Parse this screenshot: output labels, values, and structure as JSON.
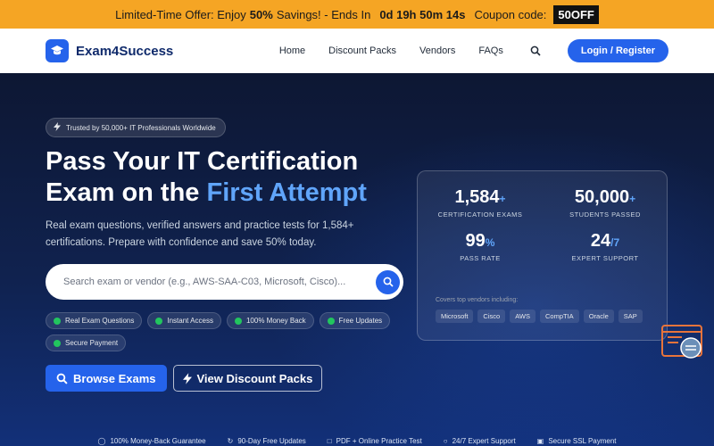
{
  "promo": {
    "prefix": "Limited-Time Offer: Enjoy",
    "percent": "50%",
    "middle": "Savings! - Ends In",
    "timer": "0d 19h 50m 14s",
    "coupon_label": "Coupon code:",
    "coupon_code": "50OFF"
  },
  "nav": {
    "brand": "Exam4Success",
    "links": [
      "Home",
      "Discount Packs",
      "Vendors",
      "FAQs"
    ],
    "login": "Login / Register"
  },
  "hero": {
    "trust_badge": "Trusted by 50,000+ IT Professionals Worldwide",
    "headline_line1": "Pass Your IT Certification",
    "headline_line2_prefix": "Exam on the",
    "headline_highlight": "First Attempt",
    "lead": "Real exam questions, verified answers and practice tests for 1,584+ certifications. Prepare with confidence and save 50% today.",
    "search_placeholder": "Search exam or vendor (e.g., AWS-SAA-C03, Microsoft, Cisco)...",
    "chips": [
      "Real Exam Questions",
      "Instant Access",
      "100% Money Back",
      "Free Updates",
      "Secure Payment"
    ],
    "browse_label": "Browse Exams",
    "discount_label": "View Discount Packs"
  },
  "stats": {
    "items": [
      {
        "value": "1,584",
        "suffix": "+",
        "label": "CERTIFICATION EXAMS"
      },
      {
        "value": "50,000",
        "suffix": "+",
        "label": "STUDENTS PASSED"
      },
      {
        "value": "99",
        "suffix": "%",
        "label": "PASS RATE"
      },
      {
        "value": "24",
        "suffix": "/7",
        "label": "EXPERT SUPPORT"
      }
    ],
    "vendors_title": "Covers top vendors including:",
    "vendors": [
      "Microsoft",
      "Cisco",
      "AWS",
      "CompTIA",
      "Oracle",
      "SAP"
    ]
  },
  "features": [
    "100% Money-Back Guarantee",
    "90-Day Free Updates",
    "PDF + Online Practice Test",
    "24/7 Expert Support",
    "Secure SSL Payment"
  ],
  "colors": {
    "accent": "#2563eb",
    "promo": "#f5a524",
    "highlight": "#60a5fa",
    "success": "#22c55e"
  }
}
